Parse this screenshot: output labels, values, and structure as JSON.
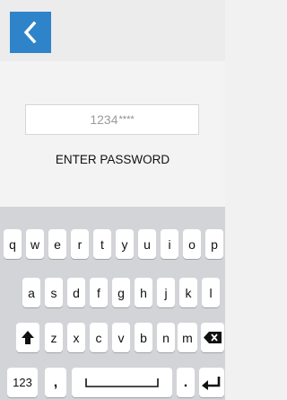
{
  "header": {
    "back_icon": "chevron-left-icon",
    "accent_color": "#2f84c9"
  },
  "password": {
    "value": "1234",
    "mask": "****",
    "label": "ENTER PASSWORD"
  },
  "keyboard": {
    "row1": [
      "q",
      "w",
      "e",
      "r",
      "t",
      "y",
      "u",
      "i",
      "o",
      "p"
    ],
    "row2": [
      "a",
      "s",
      "d",
      "f",
      "g",
      "h",
      "j",
      "k",
      "l"
    ],
    "row3": [
      "z",
      "x",
      "c",
      "v",
      "b",
      "n",
      "m"
    ],
    "numbers_key": "123",
    "comma_key": ",",
    "period_key": ".",
    "shift_icon": "shift-up-arrow-icon",
    "backspace_icon": "backspace-icon",
    "space_icon": "space-bar-icon",
    "enter_icon": "enter-return-icon"
  }
}
